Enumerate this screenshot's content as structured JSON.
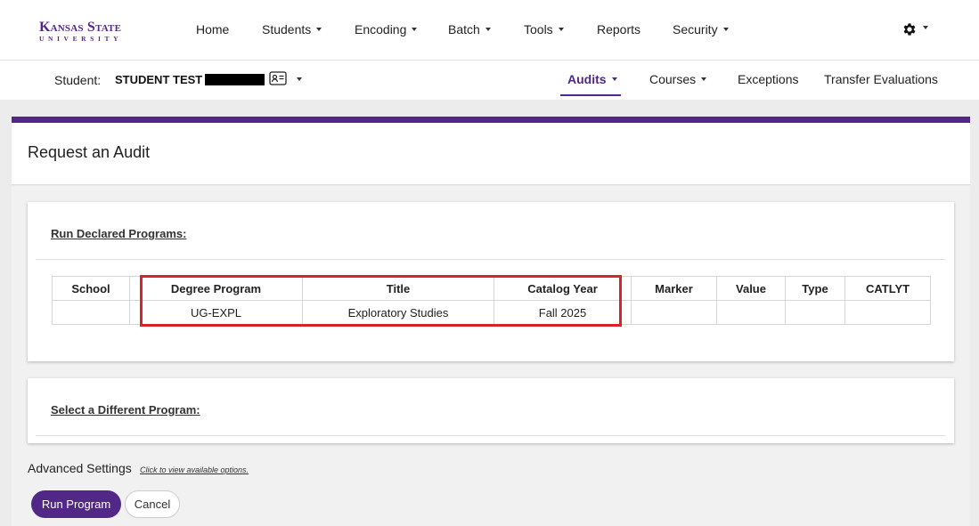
{
  "brand": {
    "line1": "Kansas State",
    "line2": "UNIVERSITY",
    "color": "#512888"
  },
  "topnav": {
    "items": [
      {
        "label": "Home",
        "dropdown": false
      },
      {
        "label": "Students",
        "dropdown": true
      },
      {
        "label": "Encoding",
        "dropdown": true
      },
      {
        "label": "Batch",
        "dropdown": true
      },
      {
        "label": "Tools",
        "dropdown": true
      },
      {
        "label": "Reports",
        "dropdown": false
      },
      {
        "label": "Security",
        "dropdown": true
      }
    ],
    "settings_icon": "gear-icon"
  },
  "student": {
    "label": "Student:",
    "name": "STUDENT TEST /"
  },
  "subnav": {
    "items": [
      {
        "label": "Audits",
        "dropdown": true,
        "active": true
      },
      {
        "label": "Courses",
        "dropdown": true,
        "active": false
      },
      {
        "label": "Exceptions",
        "dropdown": false,
        "active": false
      },
      {
        "label": "Transfer Evaluations",
        "dropdown": false,
        "active": false
      }
    ]
  },
  "page": {
    "title": "Request an Audit"
  },
  "declared": {
    "title": "Run Declared Programs:",
    "columns": [
      "School",
      "Degree Program",
      "Title",
      "Catalog Year",
      "Marker",
      "Value",
      "Type",
      "CATLYT"
    ],
    "rows": [
      [
        "",
        "UG-EXPL",
        "Exploratory Studies",
        "Fall 2025",
        "",
        "",
        "",
        ""
      ]
    ]
  },
  "different": {
    "title": "Select a Different Program:"
  },
  "advanced": {
    "label": "Advanced Settings",
    "link": "Click to view available options."
  },
  "buttons": {
    "run": "Run Program",
    "cancel": "Cancel"
  },
  "colors": {
    "accent": "#512888",
    "highlight": "#d9232a"
  }
}
